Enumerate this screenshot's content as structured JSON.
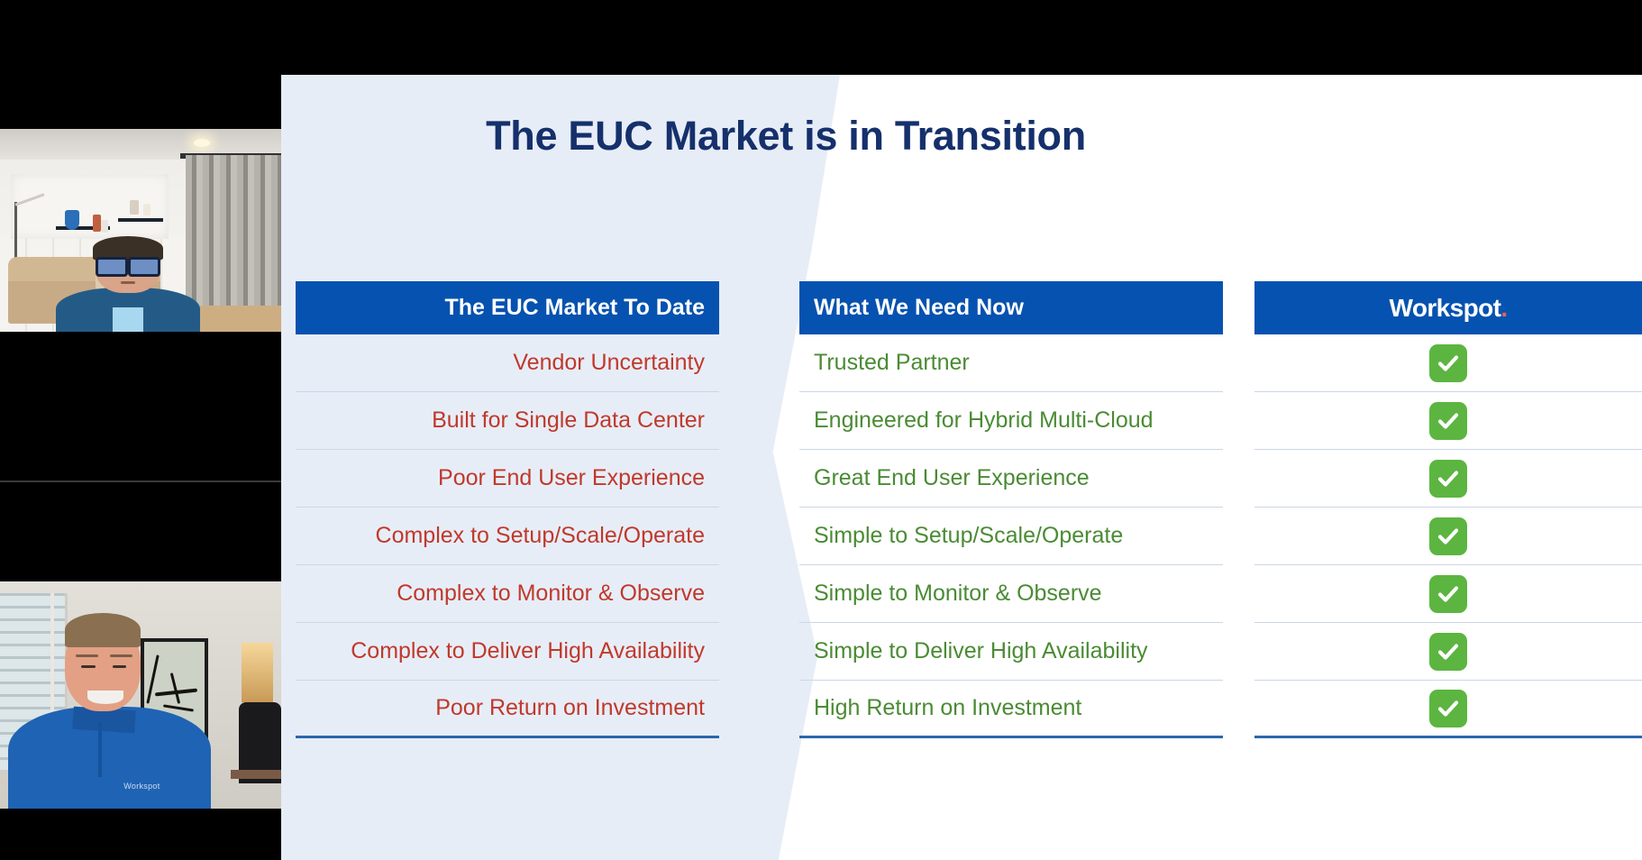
{
  "meeting": {
    "participants": [
      {
        "name": "participant-1",
        "description": "Man with dark glasses in a living room with beige sofa and grey curtains"
      },
      {
        "name": "participant-2",
        "description": "Man in blue Workspot polo shirt in a home office with framed calligraphy art",
        "shirt_logo_text": "Workspot"
      }
    ]
  },
  "slide": {
    "title": "The EUC Market is in Transition",
    "title_color": "#15306b",
    "accent_blue": "#0652b0",
    "panel_bg": "#e7edf7",
    "negative_color": "#c0392b",
    "positive_color": "#4a8b34",
    "check_color": "#5cb540",
    "columns": {
      "left": {
        "header": "The EUC Market To Date",
        "rows": [
          "Vendor Uncertainty",
          "Built for Single Data Center",
          "Poor End User Experience",
          "Complex to Setup/Scale/Operate",
          "Complex to Monitor & Observe",
          "Complex to Deliver High Availability",
          "Poor Return on Investment"
        ]
      },
      "middle": {
        "header": "What We Need Now",
        "rows": [
          "Trusted Partner",
          "Engineered for Hybrid Multi-Cloud",
          "Great End User Experience",
          "Simple to Setup/Scale/Operate",
          "Simple to Monitor & Observe",
          "Simple to Deliver High Availability",
          "High Return on Investment"
        ]
      },
      "right": {
        "header_logo": "Workspot",
        "header_logo_dot": ".",
        "rows": [
          "check-icon",
          "check-icon",
          "check-icon",
          "check-icon",
          "check-icon",
          "check-icon",
          "check-icon"
        ]
      }
    }
  }
}
